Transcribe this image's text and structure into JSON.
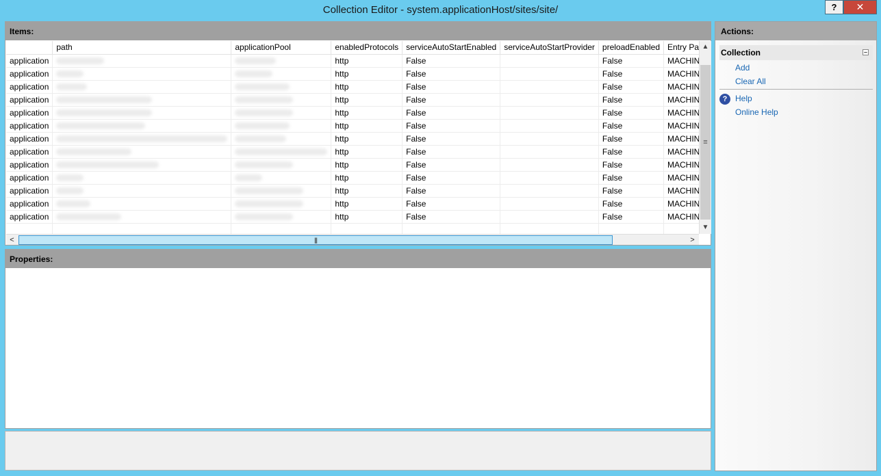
{
  "window": {
    "title": "Collection Editor - system.applicationHost/sites/site/",
    "help_button": "?",
    "close_button": "✕"
  },
  "items": {
    "header": "Items:",
    "columns": [
      "",
      "path",
      "applicationPool",
      "enabledProtocols",
      "serviceAutoStartEnabled",
      "serviceAutoStartProvider",
      "preloadEnabled",
      "Entry Path"
    ],
    "rows": [
      [
        "application",
        "",
        "",
        "http",
        "False",
        "",
        "False",
        "MACHINE"
      ],
      [
        "application",
        "",
        "",
        "http",
        "False",
        "",
        "False",
        "MACHINE"
      ],
      [
        "application",
        "",
        "",
        "http",
        "False",
        "",
        "False",
        "MACHINE"
      ],
      [
        "application",
        "",
        "",
        "http",
        "False",
        "",
        "False",
        "MACHINE"
      ],
      [
        "application",
        "",
        "",
        "http",
        "False",
        "",
        "False",
        "MACHINE"
      ],
      [
        "application",
        "",
        "",
        "http",
        "False",
        "",
        "False",
        "MACHINE"
      ],
      [
        "application",
        "",
        "",
        "http",
        "False",
        "",
        "False",
        "MACHINE"
      ],
      [
        "application",
        "",
        "",
        "http",
        "False",
        "",
        "False",
        "MACHINE"
      ],
      [
        "application",
        "",
        "",
        "http",
        "False",
        "",
        "False",
        "MACHINE"
      ],
      [
        "application",
        "",
        "",
        "http",
        "False",
        "",
        "False",
        "MACHINE"
      ],
      [
        "application",
        "",
        "",
        "http",
        "False",
        "",
        "False",
        "MACHINE"
      ],
      [
        "application",
        "",
        "",
        "http",
        "False",
        "",
        "False",
        "MACHINE"
      ],
      [
        "application",
        "",
        "",
        "http",
        "False",
        "",
        "False",
        "MACHINE"
      ]
    ]
  },
  "properties": {
    "header": "Properties:"
  },
  "actions": {
    "header": "Actions:",
    "group_label": "Collection",
    "add_label": "Add",
    "clear_all_label": "Clear All",
    "help_label": "Help",
    "online_help_label": "Online Help"
  },
  "colors": {
    "window_frame": "#6acbee",
    "panel_header": "#a0a0a0",
    "link": "#1866b3",
    "close_button": "#c7473a"
  }
}
